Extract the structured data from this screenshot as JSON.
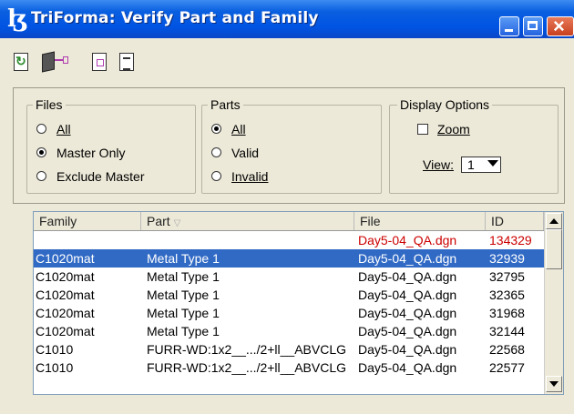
{
  "window": {
    "title": "TriForma: Verify Part and Family",
    "app_icon": "triforma-logo-icon",
    "colors": {
      "titlebar": "#0054e3",
      "selection": "#316ac5",
      "highlight_text": "#cc0000"
    }
  },
  "toolbar": {
    "icons": [
      "refresh-icon",
      "part-family-icon",
      "document-icon",
      "report-icon"
    ]
  },
  "files": {
    "label": "Files",
    "options": [
      {
        "label": "All",
        "selected": false
      },
      {
        "label": "Master Only",
        "selected": true
      },
      {
        "label": "Exclude Master",
        "selected": false
      }
    ]
  },
  "parts": {
    "label": "Parts",
    "options": [
      {
        "label": "All",
        "selected": true
      },
      {
        "label": "Valid",
        "selected": false
      },
      {
        "label": "Invalid",
        "selected": false
      }
    ]
  },
  "display": {
    "label": "Display Options",
    "zoom_label": "Zoom",
    "zoom_checked": false,
    "view_label": "View:",
    "view_value": "1"
  },
  "table": {
    "headers": {
      "family": "Family",
      "part": "Part",
      "file": "File",
      "id": "ID"
    },
    "rows": [
      {
        "family": "",
        "part": "",
        "file": "Day5-04_QA.dgn",
        "id": "134329",
        "state": "red"
      },
      {
        "family": "C1020mat",
        "part": "Metal Type 1",
        "file": "Day5-04_QA.dgn",
        "id": "32939",
        "state": "selected"
      },
      {
        "family": "C1020mat",
        "part": "Metal Type 1",
        "file": "Day5-04_QA.dgn",
        "id": "32795",
        "state": ""
      },
      {
        "family": "C1020mat",
        "part": "Metal Type 1",
        "file": "Day5-04_QA.dgn",
        "id": "32365",
        "state": ""
      },
      {
        "family": "C1020mat",
        "part": "Metal Type 1",
        "file": "Day5-04_QA.dgn",
        "id": "31968",
        "state": ""
      },
      {
        "family": "C1020mat",
        "part": "Metal Type 1",
        "file": "Day5-04_QA.dgn",
        "id": "32144",
        "state": ""
      },
      {
        "family": "C1010",
        "part": "FURR-WD:1x2__.../2+ll__ABVCLG",
        "file": "Day5-04_QA.dgn",
        "id": "22568",
        "state": ""
      },
      {
        "family": "C1010",
        "part": "FURR-WD:1x2__.../2+ll__ABVCLG",
        "file": "Day5-04_QA.dgn",
        "id": "22577",
        "state": ""
      }
    ]
  }
}
